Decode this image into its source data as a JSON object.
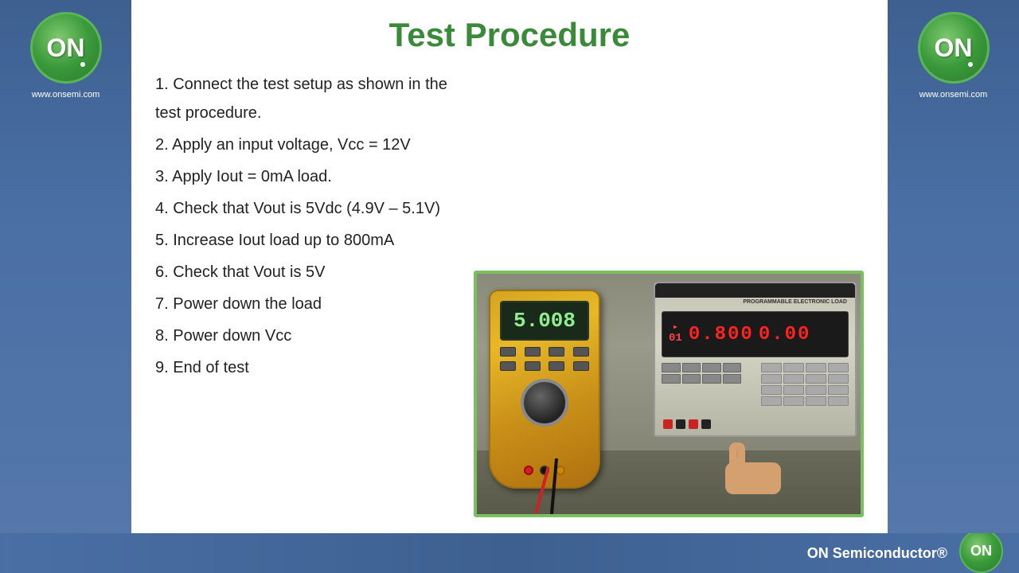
{
  "header": {
    "title": "Test Procedure"
  },
  "logos": {
    "left": {
      "text": "ON",
      "website": "www.onsemi.com"
    },
    "right": {
      "text": "ON",
      "website": "www.onsemi.com"
    },
    "footer": {
      "text": "ON"
    }
  },
  "steps": [
    {
      "number": "1",
      "text": "Connect the test setup as shown in the test procedure."
    },
    {
      "number": "2",
      "text": "Apply an input voltage, Vcc = 12V"
    },
    {
      "number": "3",
      "text": "Apply Iout = 0mA load."
    },
    {
      "number": "4",
      "text": "Check that Vout is 5Vdc (4.9V – 5.1V)"
    },
    {
      "number": "5",
      "text": "Increase Iout load up to 800mA"
    },
    {
      "number": "6",
      "text": "Check that Vout is 5V"
    },
    {
      "number": "7",
      "text": "Power down the load"
    },
    {
      "number": "8",
      "text": "Power down Vcc"
    },
    {
      "number": "9",
      "text": "End of test"
    }
  ],
  "equipment": {
    "multimeter_display": "5.008",
    "eload_display_left": "0.800",
    "eload_display_right": "0.00",
    "eload_channel": "01"
  },
  "footer": {
    "company": "ON Semiconductor®"
  }
}
